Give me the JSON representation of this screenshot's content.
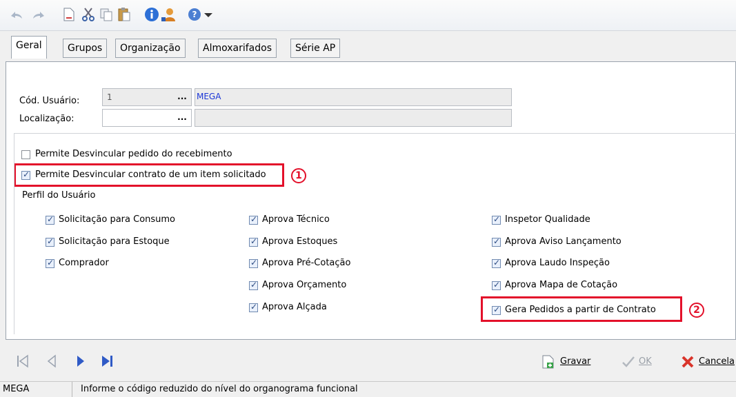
{
  "tabs": [
    {
      "label": "Geral",
      "active": true
    },
    {
      "label": "Grupos"
    },
    {
      "label": "Organização"
    },
    {
      "label": "Almoxarifados"
    },
    {
      "label": "Série AP"
    }
  ],
  "form": {
    "cod_usuario_label": "Cód. Usuário:",
    "cod_usuario_value": "1",
    "cod_usuario_name": "MEGA",
    "localizacao_label": "Localização:",
    "lookup_button": "..."
  },
  "options": {
    "desvincular_pedido": {
      "label": "Permite Desvincular pedido do recebimento",
      "checked": false
    },
    "desvincular_contrato": {
      "label": "Permite Desvincular contrato de um item solicitado",
      "checked": true
    }
  },
  "perfil": {
    "title": "Perfil do Usuário",
    "col1": [
      {
        "label": "Solicitação para Consumo",
        "checked": true
      },
      {
        "label": "Solicitação para Estoque",
        "checked": true
      },
      {
        "label": "Comprador",
        "checked": true
      }
    ],
    "col2": [
      {
        "label": "Aprova Técnico",
        "checked": true
      },
      {
        "label": "Aprova Estoques",
        "checked": true
      },
      {
        "label": "Aprova Pré-Cotação",
        "checked": true
      },
      {
        "label": "Aprova Orçamento",
        "checked": true
      },
      {
        "label": "Aprova Alçada",
        "checked": true
      }
    ],
    "col3": [
      {
        "label": "Inspetor Qualidade",
        "checked": true
      },
      {
        "label": "Aprova Aviso Lançamento",
        "checked": true
      },
      {
        "label": "Aprova Laudo Inspeção",
        "checked": true
      },
      {
        "label": "Aprova Mapa de Cotação",
        "checked": true
      },
      {
        "label": "Gera Pedidos a partir de Contrato",
        "checked": true
      }
    ]
  },
  "annotations": {
    "one": "1",
    "two": "2"
  },
  "actions": {
    "gravar": "Gravar",
    "ok": "OK",
    "cancelar": "Cancela"
  },
  "status": {
    "left": "MEGA",
    "message": "Informe o código reduzido do nível do organograma funcional"
  },
  "colors": {
    "annotation_red": "#e3102a",
    "link_blue": "#1a35d6"
  }
}
